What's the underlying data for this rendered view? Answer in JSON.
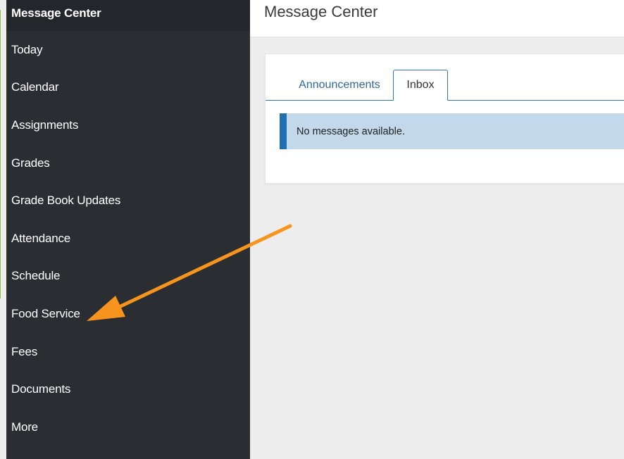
{
  "header": {
    "title": "Message Center"
  },
  "sidebar": {
    "active_label": "Message Center",
    "items": [
      {
        "label": "Today"
      },
      {
        "label": "Calendar"
      },
      {
        "label": "Assignments"
      },
      {
        "label": "Grades"
      },
      {
        "label": "Grade Book Updates"
      },
      {
        "label": "Attendance"
      },
      {
        "label": "Schedule"
      },
      {
        "label": "Food Service"
      },
      {
        "label": "Fees"
      },
      {
        "label": "Documents"
      },
      {
        "label": "More"
      }
    ]
  },
  "main": {
    "tabs": [
      {
        "label": "Announcements",
        "selected": false
      },
      {
        "label": "Inbox",
        "selected": true
      }
    ],
    "alert_text": "No messages available."
  },
  "annotation": {
    "arrow_color": "#f7941d",
    "points_to": "Food Service"
  },
  "colors": {
    "sidebar_bg": "#2a2d31",
    "accent": "#1f6fb2",
    "alert_bg": "#c3d8ea"
  }
}
